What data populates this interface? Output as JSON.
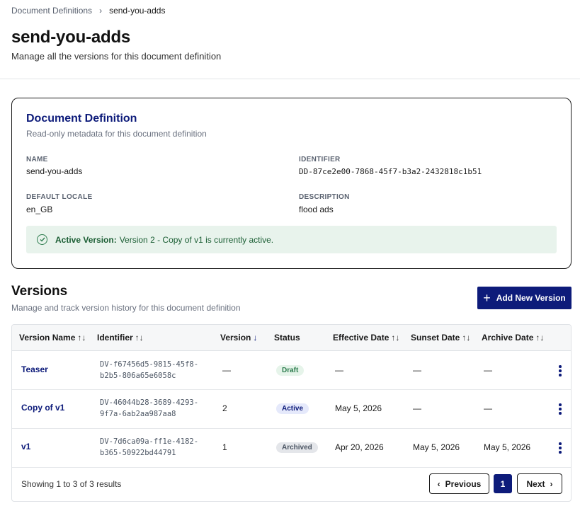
{
  "breadcrumb": {
    "parent": "Document Definitions",
    "current": "send-you-adds"
  },
  "page": {
    "title": "send-you-adds",
    "subtitle": "Manage all the versions for this document definition"
  },
  "definition_card": {
    "title": "Document Definition",
    "subtitle": "Read-only metadata for this document definition",
    "fields": {
      "name_label": "NAME",
      "name_value": "send-you-adds",
      "identifier_label": "IDENTIFIER",
      "identifier_value": "DD-87ce2e00-7868-45f7-b3a2-2432818c1b51",
      "locale_label": "DEFAULT LOCALE",
      "locale_value": "en_GB",
      "description_label": "DESCRIPTION",
      "description_value": "flood ads"
    },
    "active_banner": {
      "strong": "Active Version:",
      "text": "Version 2 - Copy of v1 is currently active."
    }
  },
  "versions": {
    "title": "Versions",
    "subtitle": "Manage and track version history for this document definition",
    "add_button": "Add New Version",
    "columns": {
      "version_name": "Version Name",
      "identifier": "Identifier",
      "version": "Version",
      "status": "Status",
      "effective_date": "Effective Date",
      "sunset_date": "Sunset Date",
      "archive_date": "Archive Date"
    },
    "sort_icons": {
      "both": "↑↓",
      "down": "↓"
    },
    "rows": [
      {
        "name": "Teaser",
        "id_line1": "DV-f67456d5-9815-45f8-",
        "id_line2": "b2b5-806a65e6058c",
        "version": "—",
        "status": "Draft",
        "effective": "—",
        "sunset": "—",
        "archive": "—"
      },
      {
        "name": "Copy of v1",
        "id_line1": "DV-46044b28-3689-4293-",
        "id_line2": "9f7a-6ab2aa987aa8",
        "version": "2",
        "status": "Active",
        "effective": "May 5, 2026",
        "sunset": "—",
        "archive": "—"
      },
      {
        "name": "v1",
        "id_line1": "DV-7d6ca09a-ff1e-4182-",
        "id_line2": "b365-50922bd44791",
        "version": "1",
        "status": "Archived",
        "effective": "Apr 20, 2026",
        "sunset": "May 5, 2026",
        "archive": "May 5, 2026"
      }
    ],
    "footer": {
      "summary": "Showing 1 to 3 of 3 results",
      "previous": "Previous",
      "page": "1",
      "next": "Next"
    }
  },
  "colors": {
    "primary": "#0d1b7a",
    "active_bg": "#e8f3ec",
    "active_text": "#1b5e34",
    "draft_badge": "#e6f4ea",
    "active_badge": "#e5e9fb",
    "archived_badge": "#e4e6ea"
  }
}
